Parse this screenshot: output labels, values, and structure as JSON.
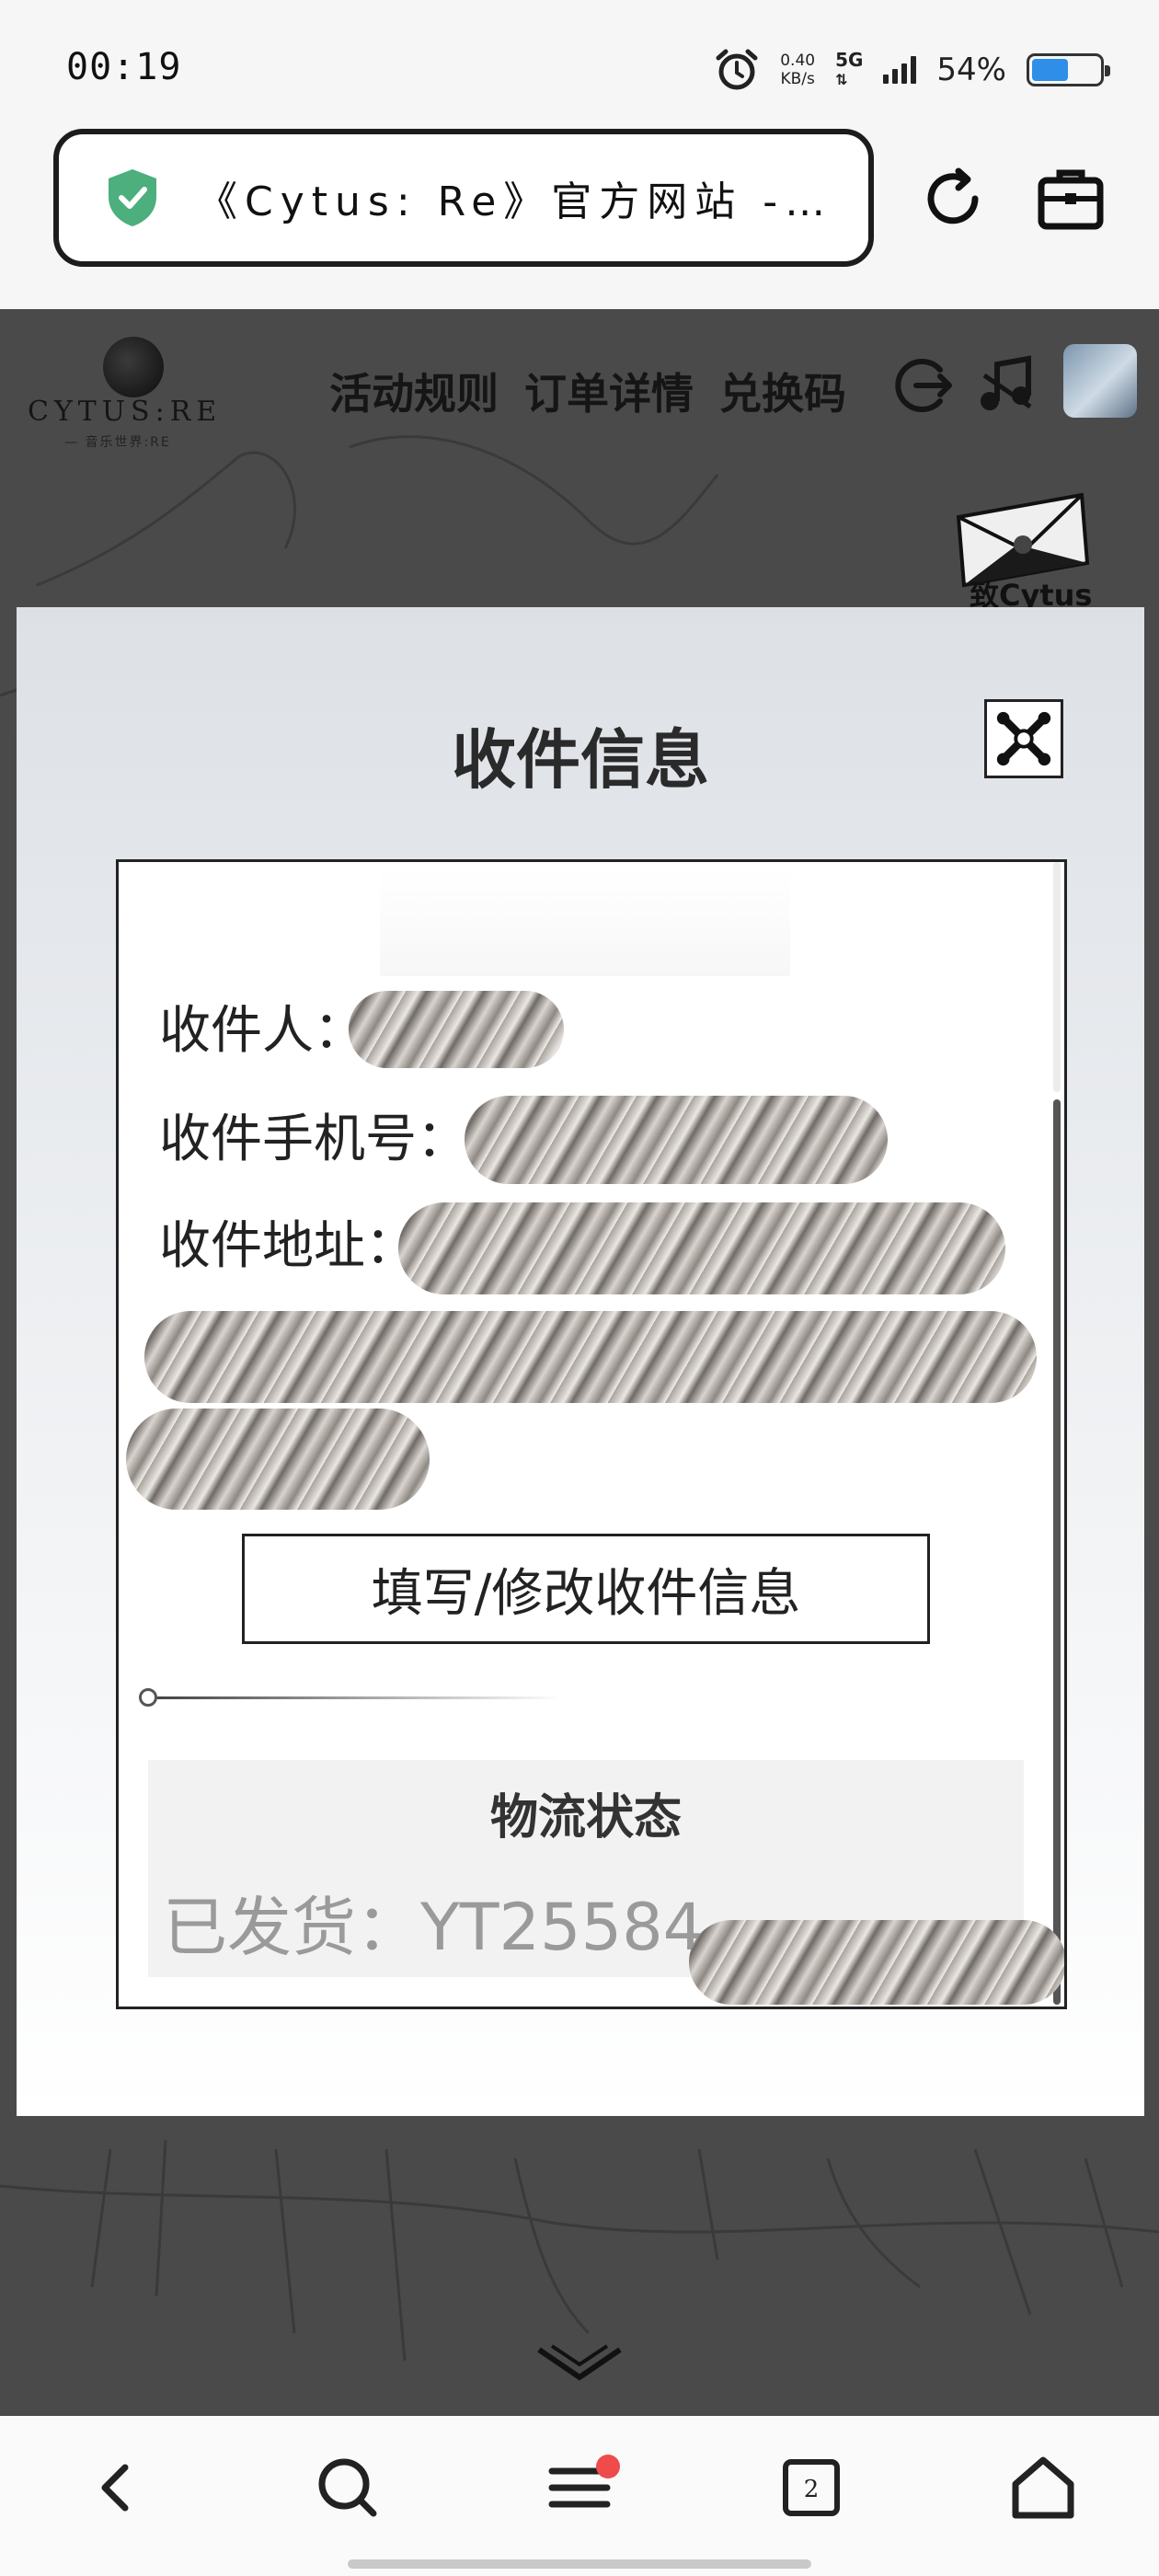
{
  "status_bar": {
    "time": "00:19",
    "net_speed_value": "0.40",
    "net_speed_unit": "KB/s",
    "network_type": "5G",
    "battery_percent": "54%",
    "battery_level": 0.54
  },
  "browser": {
    "url_title": "《Cytus: Re》官方网站 -…"
  },
  "site_header": {
    "logo_text": "CYTUS:RE",
    "logo_sub": "— 音乐世界:RE",
    "nav": [
      "活动规则",
      "订单详情",
      "兑换码"
    ],
    "envelope_label": "致Cytus"
  },
  "modal": {
    "title": "收件信息",
    "recipient_label": "收件人：",
    "phone_label": "收件手机号：",
    "address_label": "收件地址：",
    "edit_button": "填写/修改收件信息",
    "logistics_title": "物流状态",
    "logistics_status": "已发货：YT25584"
  },
  "colors": {
    "accent_shield": "#4caf7d",
    "notification": "#ef4b4b",
    "battery": "#2f8fe8"
  }
}
